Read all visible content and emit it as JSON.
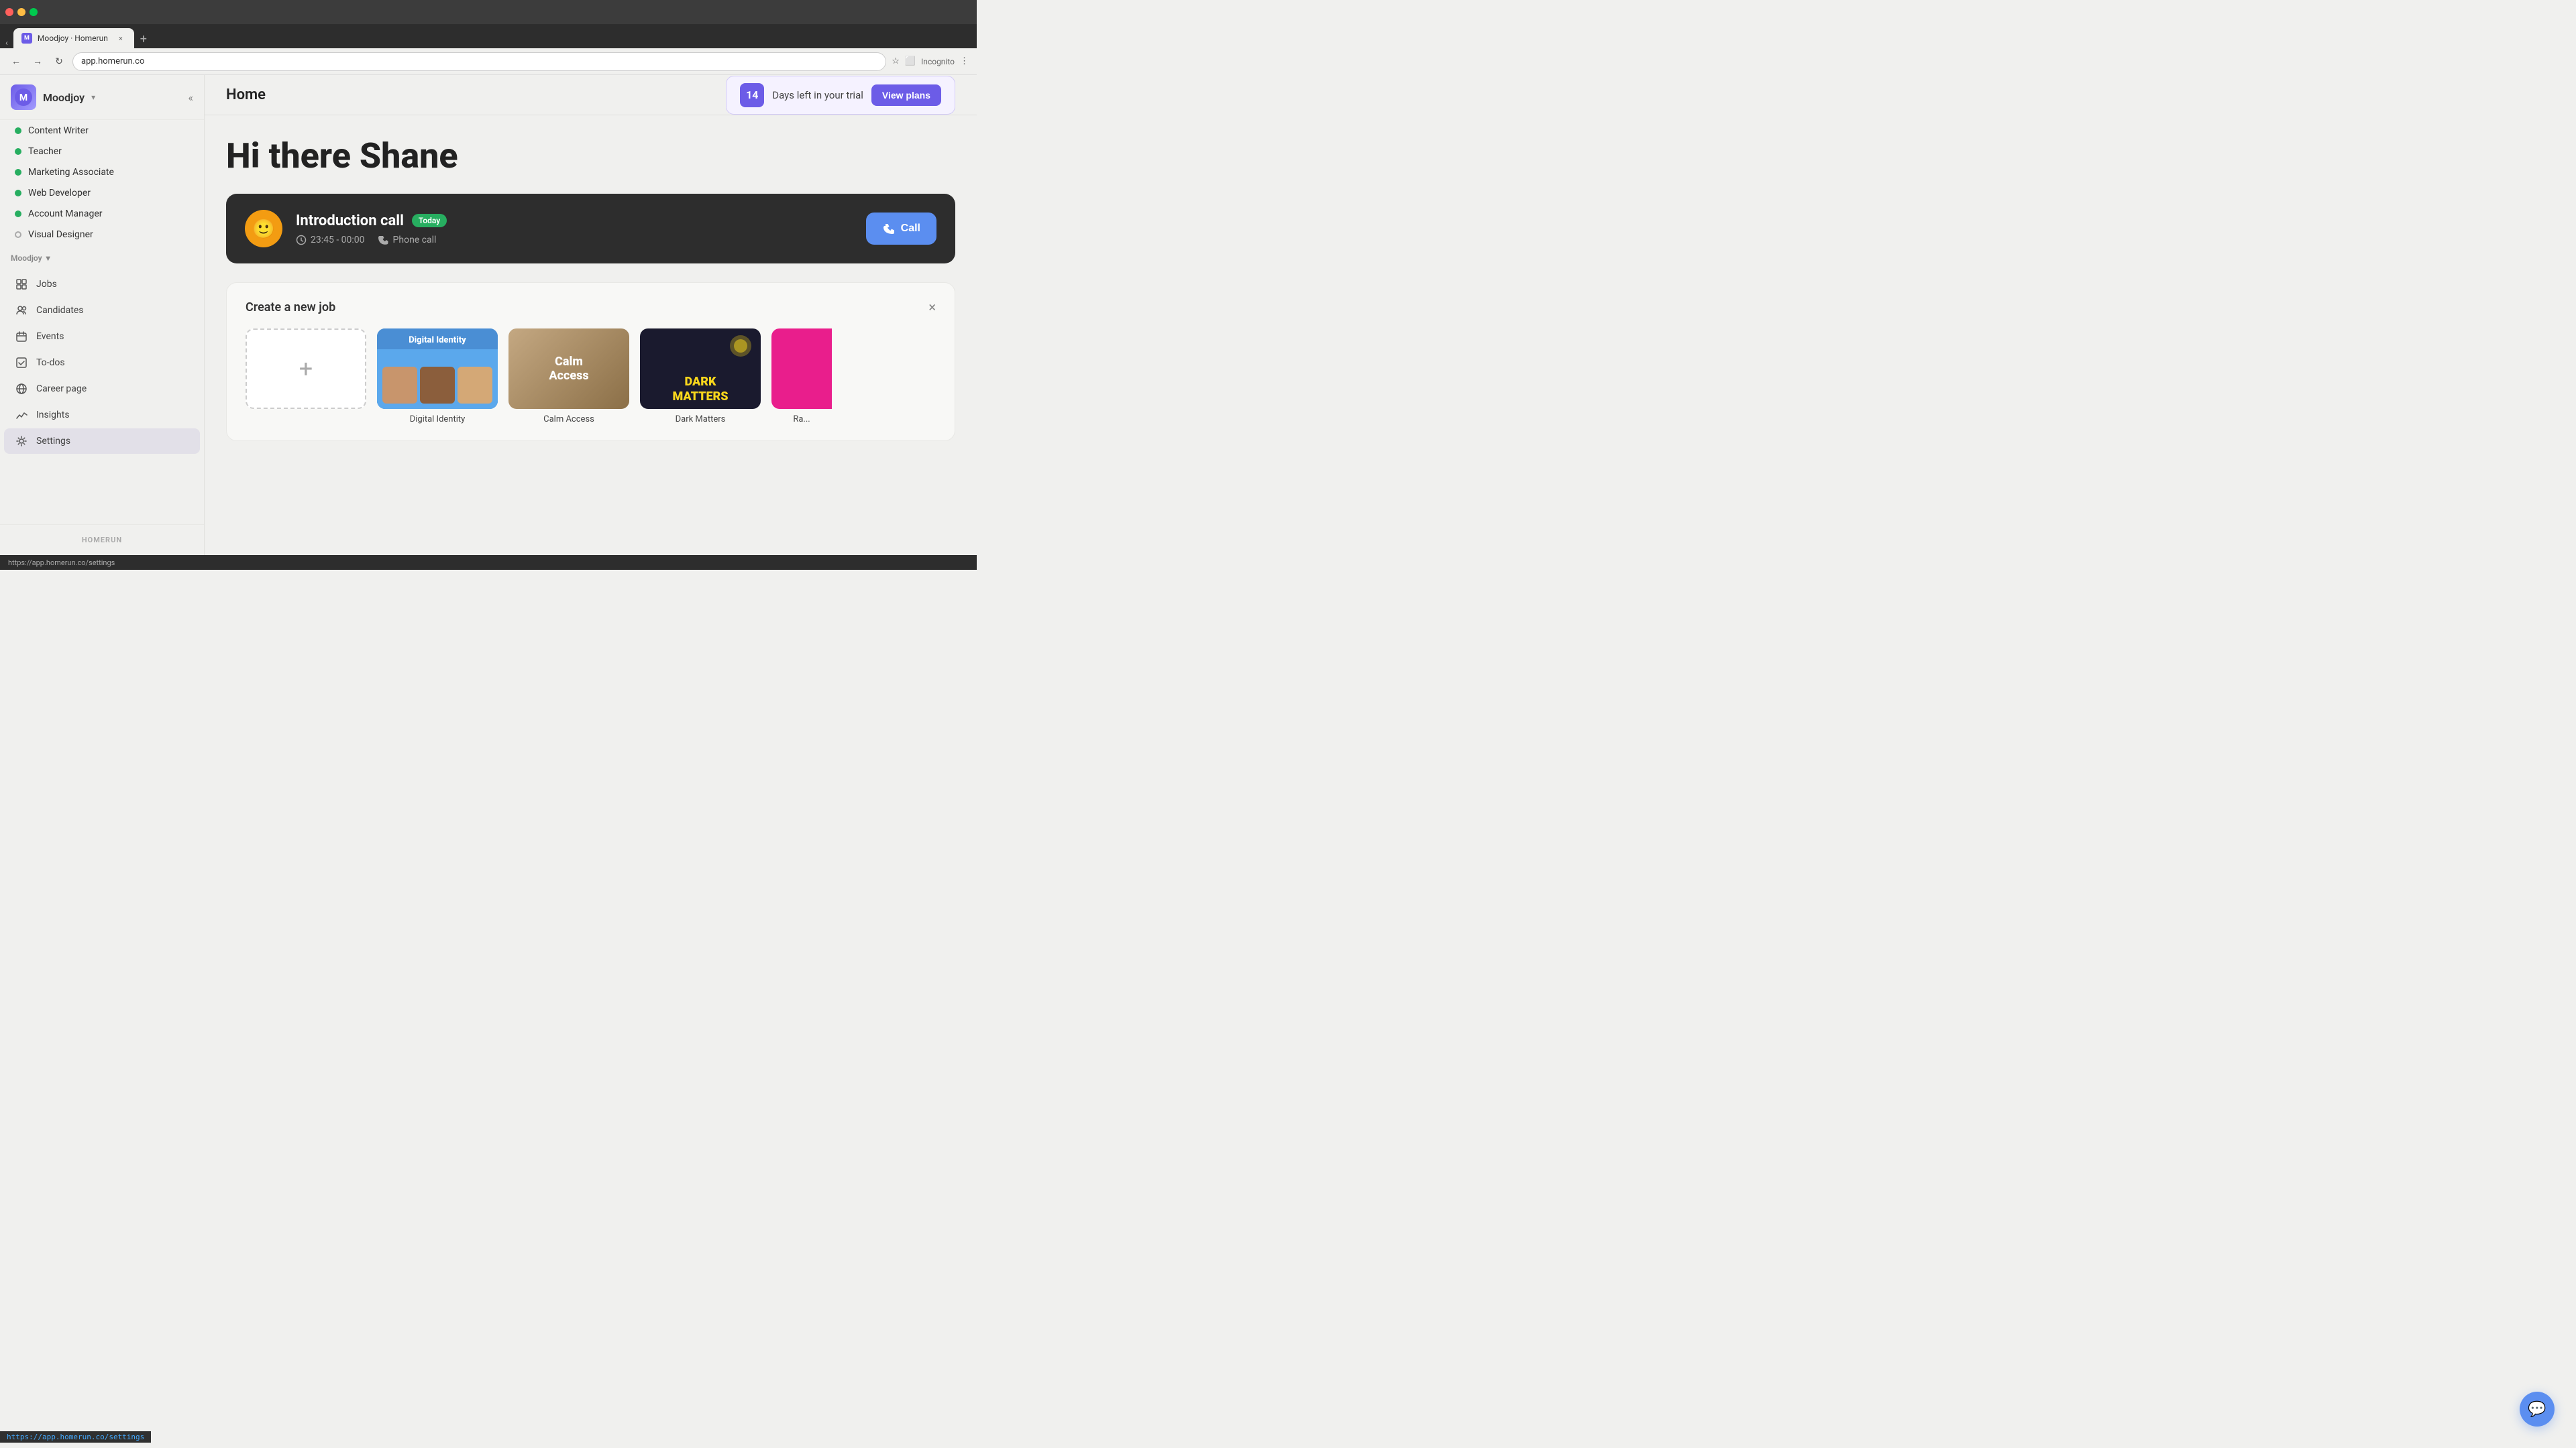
{
  "browser": {
    "tab_title": "Moodjoy · Homerun",
    "url": "app.homerun.co",
    "incognito_label": "Incognito"
  },
  "sidebar": {
    "brand_name": "Moodjoy",
    "brand_chevron": "▾",
    "collapse_icon": "«",
    "section_label": "Moodjoy",
    "section_chevron": "▾",
    "jobs": [
      {
        "label": "Content Writer",
        "status": "active"
      },
      {
        "label": "Teacher",
        "status": "active"
      },
      {
        "label": "Marketing Associate",
        "status": "active"
      },
      {
        "label": "Web Developer",
        "status": "active"
      },
      {
        "label": "Account Manager",
        "status": "active"
      },
      {
        "label": "Visual Designer",
        "status": "inactive"
      }
    ],
    "nav_items": [
      {
        "label": "Jobs",
        "icon": "grid"
      },
      {
        "label": "Candidates",
        "icon": "people"
      },
      {
        "label": "Events",
        "icon": "calendar"
      },
      {
        "label": "To-dos",
        "icon": "check"
      },
      {
        "label": "Career page",
        "icon": "globe"
      },
      {
        "label": "Insights",
        "icon": "chart"
      },
      {
        "label": "Settings",
        "icon": "gear",
        "hovered": true
      }
    ],
    "homerun_logo": "HOMERUN"
  },
  "header": {
    "page_title": "Home",
    "trial": {
      "days": "14",
      "text": "Days left in your trial",
      "view_plans": "View plans"
    }
  },
  "main": {
    "greeting": "Hi there Shane",
    "intro_card": {
      "title": "Introduction call",
      "today_badge": "Today",
      "time": "23:45 - 00:00",
      "type": "Phone call",
      "call_button": "Call"
    },
    "create_job": {
      "title": "Create a new job",
      "close_icon": "×",
      "templates": [
        {
          "type": "create_new",
          "label": ""
        },
        {
          "type": "digital_identity",
          "label": "Digital Identity"
        },
        {
          "type": "calm_access",
          "label": "Calm Access"
        },
        {
          "type": "dark_matters",
          "label": "Dark Matters"
        },
        {
          "type": "partial_pink",
          "label": "Ra..."
        }
      ]
    }
  },
  "status_bar": {
    "url": "https://app.homerun.co/settings"
  }
}
